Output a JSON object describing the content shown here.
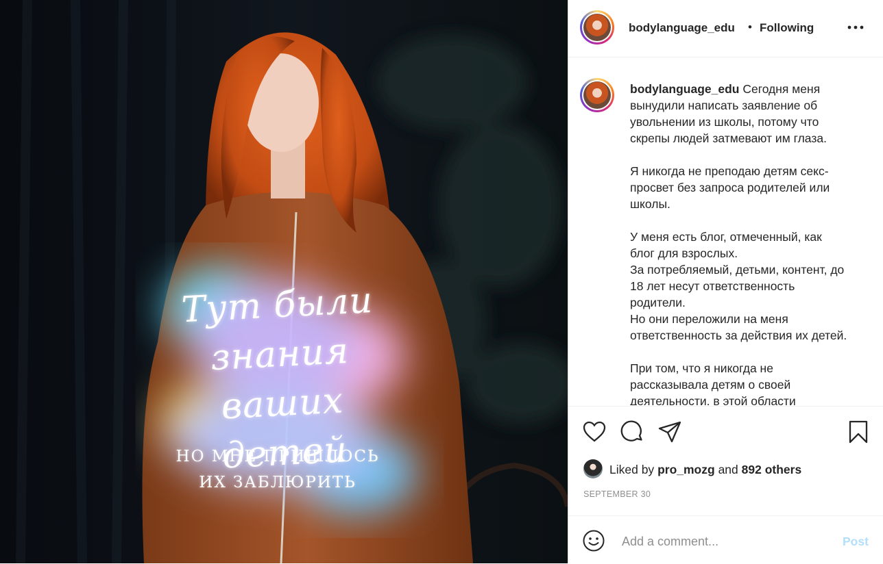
{
  "photo": {
    "overlay_title_lines": [
      "Тут были",
      "знания ваших",
      "детей"
    ],
    "overlay_sub_lines": [
      "НО МНЕ ПРИШЛОСЬ",
      "ИХ ЗАБЛЮРИТЬ"
    ]
  },
  "header": {
    "username": "bodylanguage_edu",
    "separator": "•",
    "follow_status": "Following"
  },
  "caption": {
    "username": "bodylanguage_edu",
    "text": "Сегодня меня\nвынудили написать заявление об\nувольнении из школы, потому что\nскрепы людей затмевают им глаза.\n\nЯ никогда не преподаю детям секс-\nпросвет без запроса родителей или\nшколы.\n\nУ меня есть блог, отмеченный, как\nблог для взрослых.\nЗа потребляемый, детьми, контент, до\n18 лет несут ответственность\nродители.\nНо они переложили на меня\nответственность за действия их детей.\n\nПри том, что я никогда не\nрассказывала детям о своей\nдеятельности, в этой области"
  },
  "likes": {
    "prefix": "Liked by",
    "user": "pro_mozg",
    "conjunction": "and",
    "others": "892 others"
  },
  "date": "SEPTEMBER 30",
  "comment": {
    "placeholder": "Add a comment...",
    "post_label": "Post"
  },
  "colors": {
    "post_disabled": "#b2dffc",
    "muted": "#8e8e8e",
    "text": "#262626"
  }
}
